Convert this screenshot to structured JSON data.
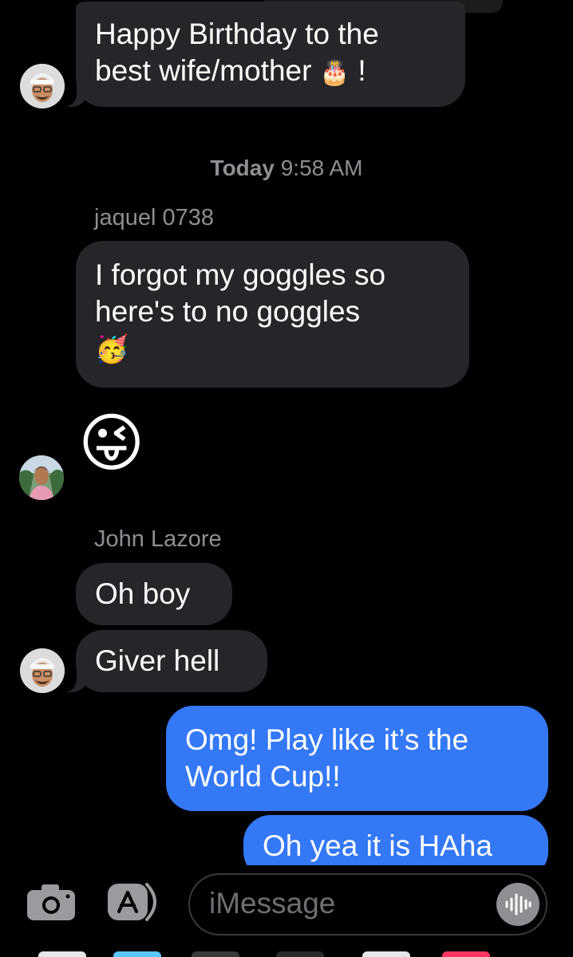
{
  "conversation": {
    "messages": [
      {
        "text_line1": "Happy Birthday to the",
        "text_line2": "best wife/mother",
        "emoji": "🎂",
        "suffix": "!"
      },
      {
        "timestamp_day": "Today",
        "timestamp_time": "9:58 AM"
      },
      {
        "sender": "jaquel 0738",
        "text_line1": "I forgot my goggles so",
        "text_line2": "here's to no goggles",
        "emoji": "🥳"
      },
      {
        "emoji": "😜"
      },
      {
        "sender": "John Lazore",
        "text": "Oh boy"
      },
      {
        "text": "Giver hell"
      },
      {
        "text_line1": "Omg! Play like it’s the",
        "text_line2": "World Cup!!"
      },
      {
        "text": "Oh yea it is HAha"
      }
    ]
  },
  "composer": {
    "placeholder": "iMessage"
  },
  "colors": {
    "incoming_bubble": "#26262a",
    "outgoing_bubble": "#3478f6",
    "meta_text": "#8e8e93"
  }
}
